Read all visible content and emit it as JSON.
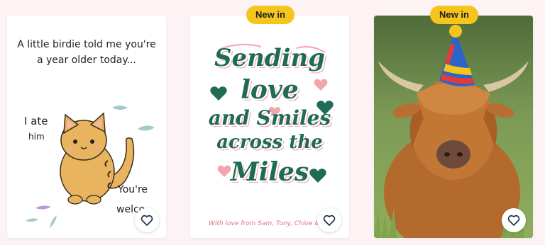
{
  "cards": [
    {
      "headline": "A little birdie told me you're a year older today...",
      "side_text_1": "I ate",
      "side_text_2": "him",
      "bottom_text_1": "You're",
      "bottom_text_2": "welco",
      "favorite_icon": "heart-outline-icon"
    },
    {
      "badge": "New in",
      "line1": "Sending",
      "line2": "love",
      "line3": "and Smiles",
      "line4": "across the",
      "line5": "Miles",
      "footer": "With love from Sam, Tony, Chloe & R",
      "favorite_icon": "heart-outline-icon"
    },
    {
      "badge": "New in",
      "favorite_icon": "heart-outline-icon"
    }
  ],
  "colors": {
    "background": "#fdf2f4",
    "badge": "#f4c51c",
    "card2_green": "#1f6b55",
    "card2_pink": "#f3a5ae"
  }
}
